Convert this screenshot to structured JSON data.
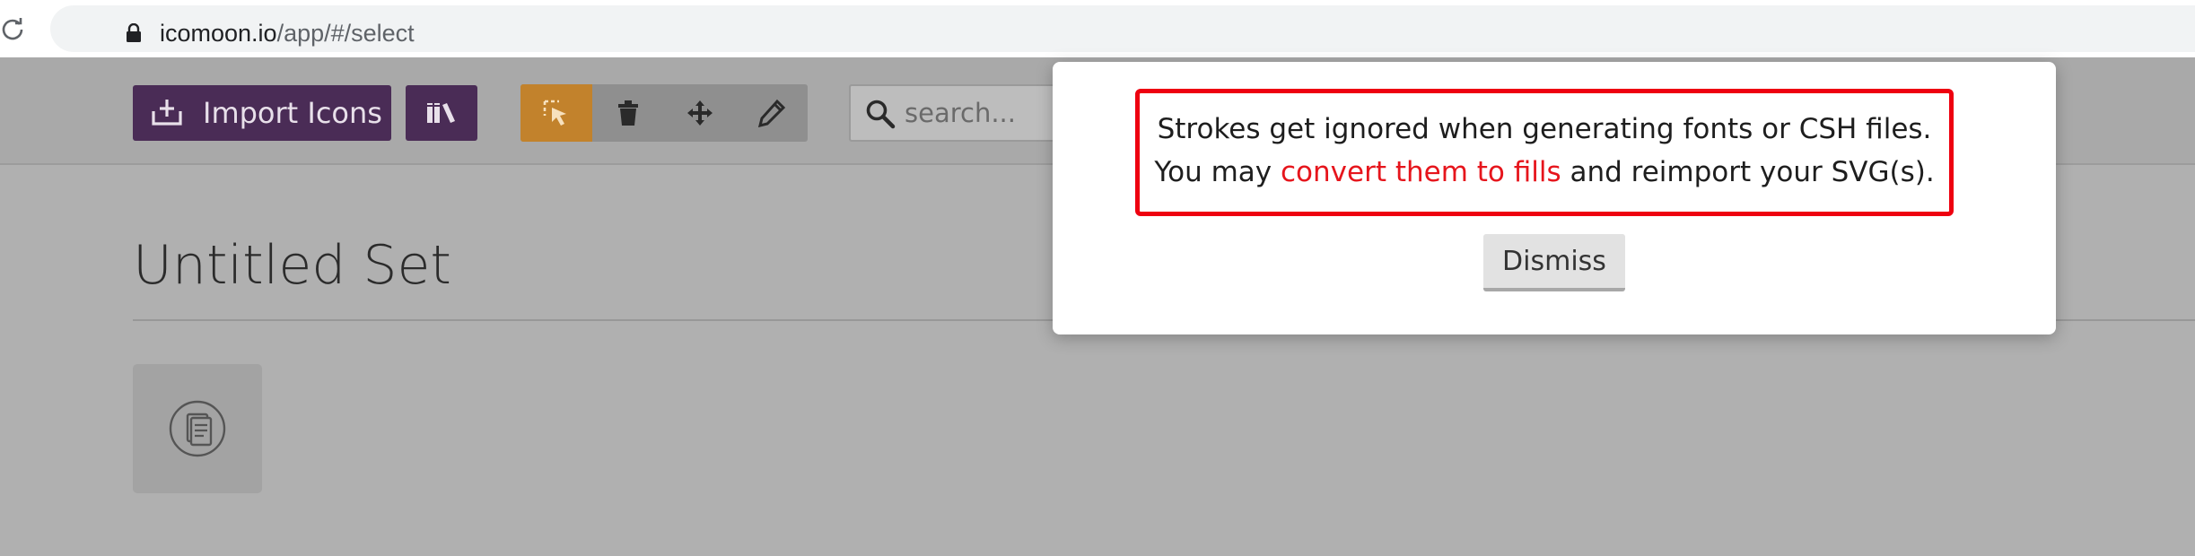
{
  "browser": {
    "url_host": "icomoon.io",
    "url_path": "/app/#/select",
    "icons": {
      "reload": "reload-icon",
      "secure": "lock-icon"
    }
  },
  "toolbar": {
    "import_label": "Import Icons",
    "icons": {
      "import": "import-icon",
      "library": "library-icon",
      "select": "select-cursor-icon",
      "delete": "trash-icon",
      "move": "move-arrows-icon",
      "edit": "pencil-icon",
      "search": "search-icon"
    },
    "active_tool": "select",
    "search_placeholder": "search..."
  },
  "main": {
    "set_title": "Untitled Set",
    "icon_tiles": [
      {
        "icon": "document-circle-icon"
      }
    ]
  },
  "popup": {
    "line1": "Strokes get ignored when generating fonts or CSH files.",
    "line2_before": "You may ",
    "line2_link": "convert them to fills",
    "line2_after": " and reimport your SVG(s).",
    "dismiss_label": "Dismiss"
  },
  "colors": {
    "brand_purple": "#4a2c56",
    "active_tool_orange": "#c2822c",
    "highlight_red": "#ee0010",
    "link_red": "#e6151c",
    "overlay_gray": "#b0b0b0"
  }
}
